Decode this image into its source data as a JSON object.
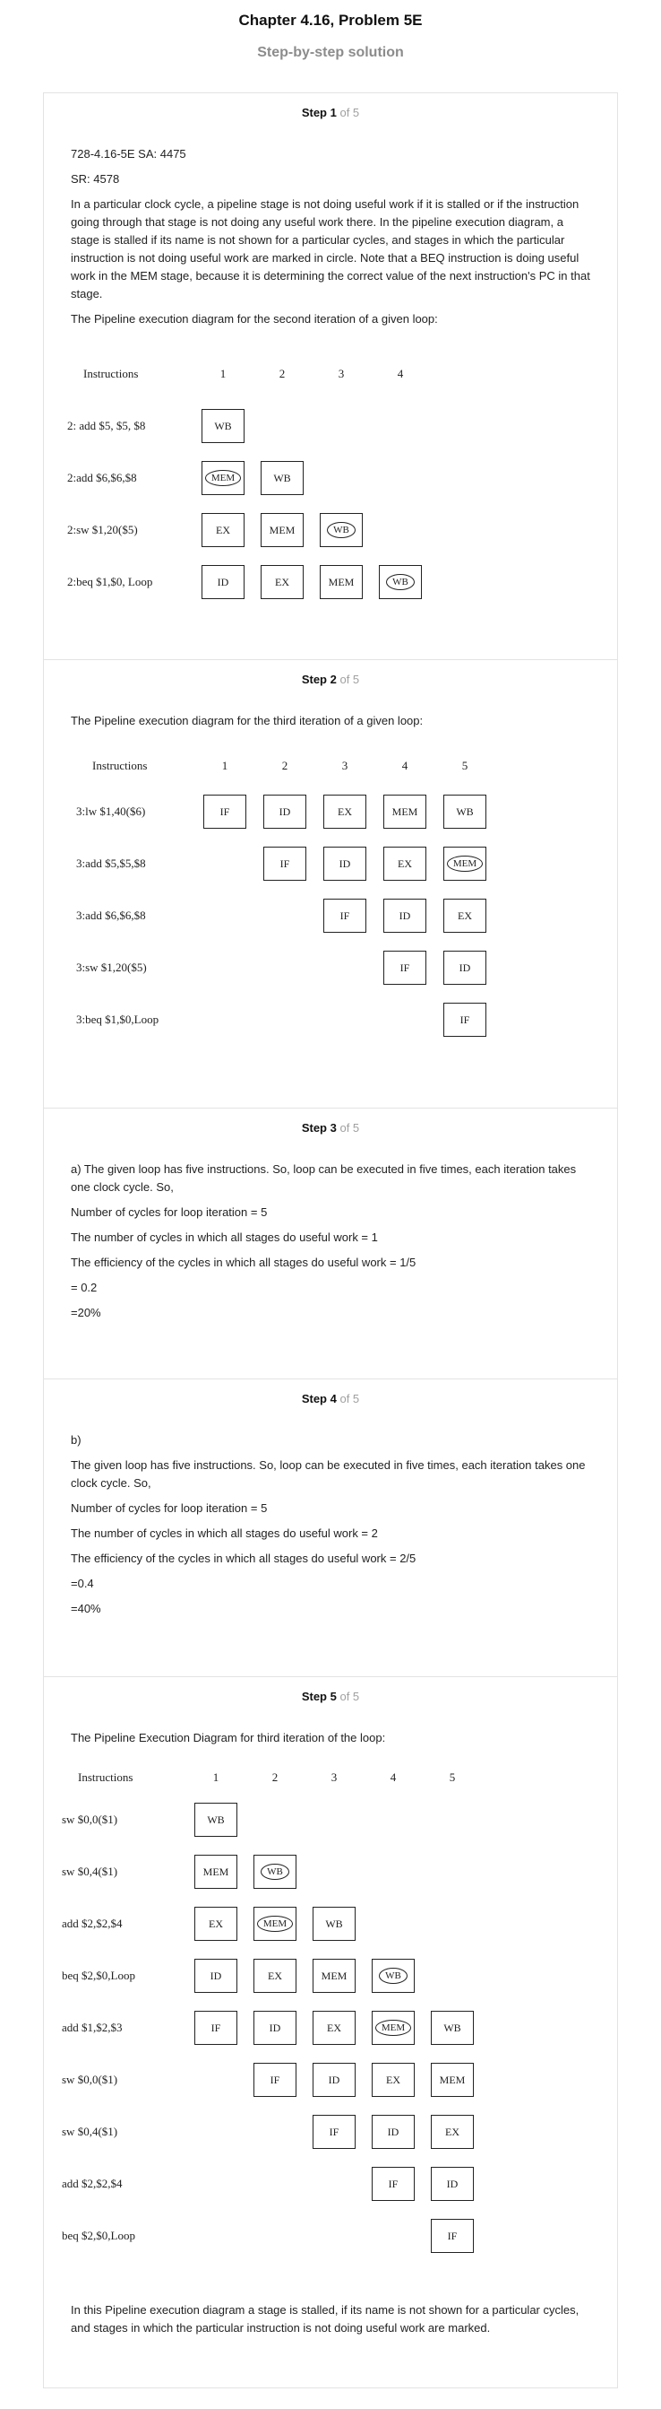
{
  "header": {
    "chapter_title": "Chapter 4.16, Problem 5E",
    "subtitle": "Step-by-step solution"
  },
  "step_of_text": "of 5",
  "steps": [
    {
      "label": "Step 1",
      "paragraphs": [
        "728-4.16-5E SA: 4475",
        "SR: 4578",
        "In a particular clock cycle, a pipeline stage is not doing useful work if it is stalled or if the instruction going through that stage is not doing any useful work there. In the pipeline execution diagram, a stage is stalled if its name is not shown for a particular cycles, and stages in which the particular instruction is not doing useful work are marked in circle. Note that a BEQ instruction is doing useful work in the MEM stage, because it is determining the correct value of the next instruction's PC in that stage.",
        "The Pipeline execution diagram for the second iteration of a given loop:"
      ],
      "diagram": {
        "header_label": "Instructions",
        "cycles": [
          "1",
          "2",
          "3",
          "4"
        ],
        "rows": [
          {
            "label": "2: add $5, $5, $8",
            "cells": [
              {
                "c": 1,
                "t": "WB",
                "circled": false
              }
            ]
          },
          {
            "label": "2:add $6,$6,$8",
            "cells": [
              {
                "c": 1,
                "t": "MEM",
                "circled": true
              },
              {
                "c": 2,
                "t": "WB",
                "circled": false
              }
            ]
          },
          {
            "label": "2:sw $1,20($5)",
            "cells": [
              {
                "c": 1,
                "t": "EX",
                "circled": false
              },
              {
                "c": 2,
                "t": "MEM",
                "circled": false
              },
              {
                "c": 3,
                "t": "WB",
                "circled": true
              }
            ]
          },
          {
            "label": "2:beq $1,$0, Loop",
            "cells": [
              {
                "c": 1,
                "t": "ID",
                "circled": false
              },
              {
                "c": 2,
                "t": "EX",
                "circled": false
              },
              {
                "c": 3,
                "t": "MEM",
                "circled": false
              },
              {
                "c": 4,
                "t": "WB",
                "circled": true
              }
            ]
          }
        ]
      }
    },
    {
      "label": "Step 2",
      "paragraphs": [
        "The Pipeline execution diagram for the third iteration of a given loop:"
      ],
      "diagram": {
        "header_label": "Instructions",
        "cycles": [
          "1",
          "2",
          "3",
          "4",
          "5"
        ],
        "rows": [
          {
            "label": "3:lw $1,40($6)",
            "cells": [
              {
                "c": 1,
                "t": "IF",
                "circled": false
              },
              {
                "c": 2,
                "t": "ID",
                "circled": false
              },
              {
                "c": 3,
                "t": "EX",
                "circled": false
              },
              {
                "c": 4,
                "t": "MEM",
                "circled": false
              },
              {
                "c": 5,
                "t": "WB",
                "circled": false
              }
            ]
          },
          {
            "label": "3:add $5,$5,$8",
            "cells": [
              {
                "c": 2,
                "t": "IF",
                "circled": false
              },
              {
                "c": 3,
                "t": "ID",
                "circled": false
              },
              {
                "c": 4,
                "t": "EX",
                "circled": false
              },
              {
                "c": 5,
                "t": "MEM",
                "circled": true
              }
            ]
          },
          {
            "label": "3:add $6,$6,$8",
            "cells": [
              {
                "c": 3,
                "t": "IF",
                "circled": false
              },
              {
                "c": 4,
                "t": "ID",
                "circled": false
              },
              {
                "c": 5,
                "t": "EX",
                "circled": false
              }
            ]
          },
          {
            "label": "3:sw $1,20($5)",
            "cells": [
              {
                "c": 4,
                "t": "IF",
                "circled": false
              },
              {
                "c": 5,
                "t": "ID",
                "circled": false
              }
            ]
          },
          {
            "label": "3:beq $1,$0,Loop",
            "cells": [
              {
                "c": 5,
                "t": "IF",
                "circled": false
              }
            ]
          }
        ]
      }
    },
    {
      "label": "Step 3",
      "paragraphs": [
        "a) The given loop has five instructions. So, loop can be executed in five times, each iteration takes one clock cycle. So,",
        "Number of cycles for loop iteration = 5",
        "The number of cycles in which all stages do useful work = 1",
        "The efficiency of the cycles in which all stages do useful work = 1/5",
        "= 0.2",
        "=20%"
      ]
    },
    {
      "label": "Step 4",
      "paragraphs": [
        "b)",
        "The given loop has five instructions. So, loop can be executed in five times, each iteration takes one clock cycle. So,",
        "Number of cycles for loop iteration = 5",
        "The number of cycles in which all stages do useful work = 2",
        "The efficiency of the cycles in which all stages do useful work = 2/5",
        "=0.4",
        "=40%"
      ]
    },
    {
      "label": "Step 5",
      "paragraphs": [
        "The Pipeline Execution Diagram for third iteration of the loop:"
      ],
      "diagram": {
        "header_label": "Instructions",
        "cycles": [
          "1",
          "2",
          "3",
          "4",
          "5"
        ],
        "rows": [
          {
            "label": "sw $0,0($1)",
            "cells": [
              {
                "c": 1,
                "t": "WB",
                "circled": false
              }
            ]
          },
          {
            "label": "sw $0,4($1)",
            "cells": [
              {
                "c": 1,
                "t": "MEM",
                "circled": false
              },
              {
                "c": 2,
                "t": "WB",
                "circled": true
              }
            ]
          },
          {
            "label": "add $2,$2,$4",
            "cells": [
              {
                "c": 1,
                "t": "EX",
                "circled": false
              },
              {
                "c": 2,
                "t": "MEM",
                "circled": true
              },
              {
                "c": 3,
                "t": "WB",
                "circled": false
              }
            ]
          },
          {
            "label": "beq $2,$0,Loop",
            "cells": [
              {
                "c": 1,
                "t": "ID",
                "circled": false
              },
              {
                "c": 2,
                "t": "EX",
                "circled": false
              },
              {
                "c": 3,
                "t": "MEM",
                "circled": false
              },
              {
                "c": 4,
                "t": "WB",
                "circled": true
              }
            ]
          },
          {
            "label": "add $1,$2,$3",
            "cells": [
              {
                "c": 1,
                "t": "IF",
                "circled": false
              },
              {
                "c": 2,
                "t": "ID",
                "circled": false
              },
              {
                "c": 3,
                "t": "EX",
                "circled": false
              },
              {
                "c": 4,
                "t": "MEM",
                "circled": true
              },
              {
                "c": 5,
                "t": "WB",
                "circled": false
              }
            ]
          },
          {
            "label": "sw $0,0($1)",
            "cells": [
              {
                "c": 2,
                "t": "IF",
                "circled": false
              },
              {
                "c": 3,
                "t": "ID",
                "circled": false
              },
              {
                "c": 4,
                "t": "EX",
                "circled": false
              },
              {
                "c": 5,
                "t": "MEM",
                "circled": false
              }
            ]
          },
          {
            "label": "sw $0,4($1)",
            "cells": [
              {
                "c": 3,
                "t": "IF",
                "circled": false
              },
              {
                "c": 4,
                "t": "ID",
                "circled": false
              },
              {
                "c": 5,
                "t": "EX",
                "circled": false
              }
            ]
          },
          {
            "label": "add $2,$2,$4",
            "cells": [
              {
                "c": 4,
                "t": "IF",
                "circled": false
              },
              {
                "c": 5,
                "t": "ID",
                "circled": false
              }
            ]
          },
          {
            "label": "beq $2,$0,Loop",
            "cells": [
              {
                "c": 5,
                "t": "IF",
                "circled": false
              }
            ]
          }
        ]
      },
      "footer_paragraph": "In this Pipeline execution diagram a stage is stalled, if its name is not shown for a particular cycles, and stages in which the particular instruction is not doing useful work are marked."
    }
  ]
}
